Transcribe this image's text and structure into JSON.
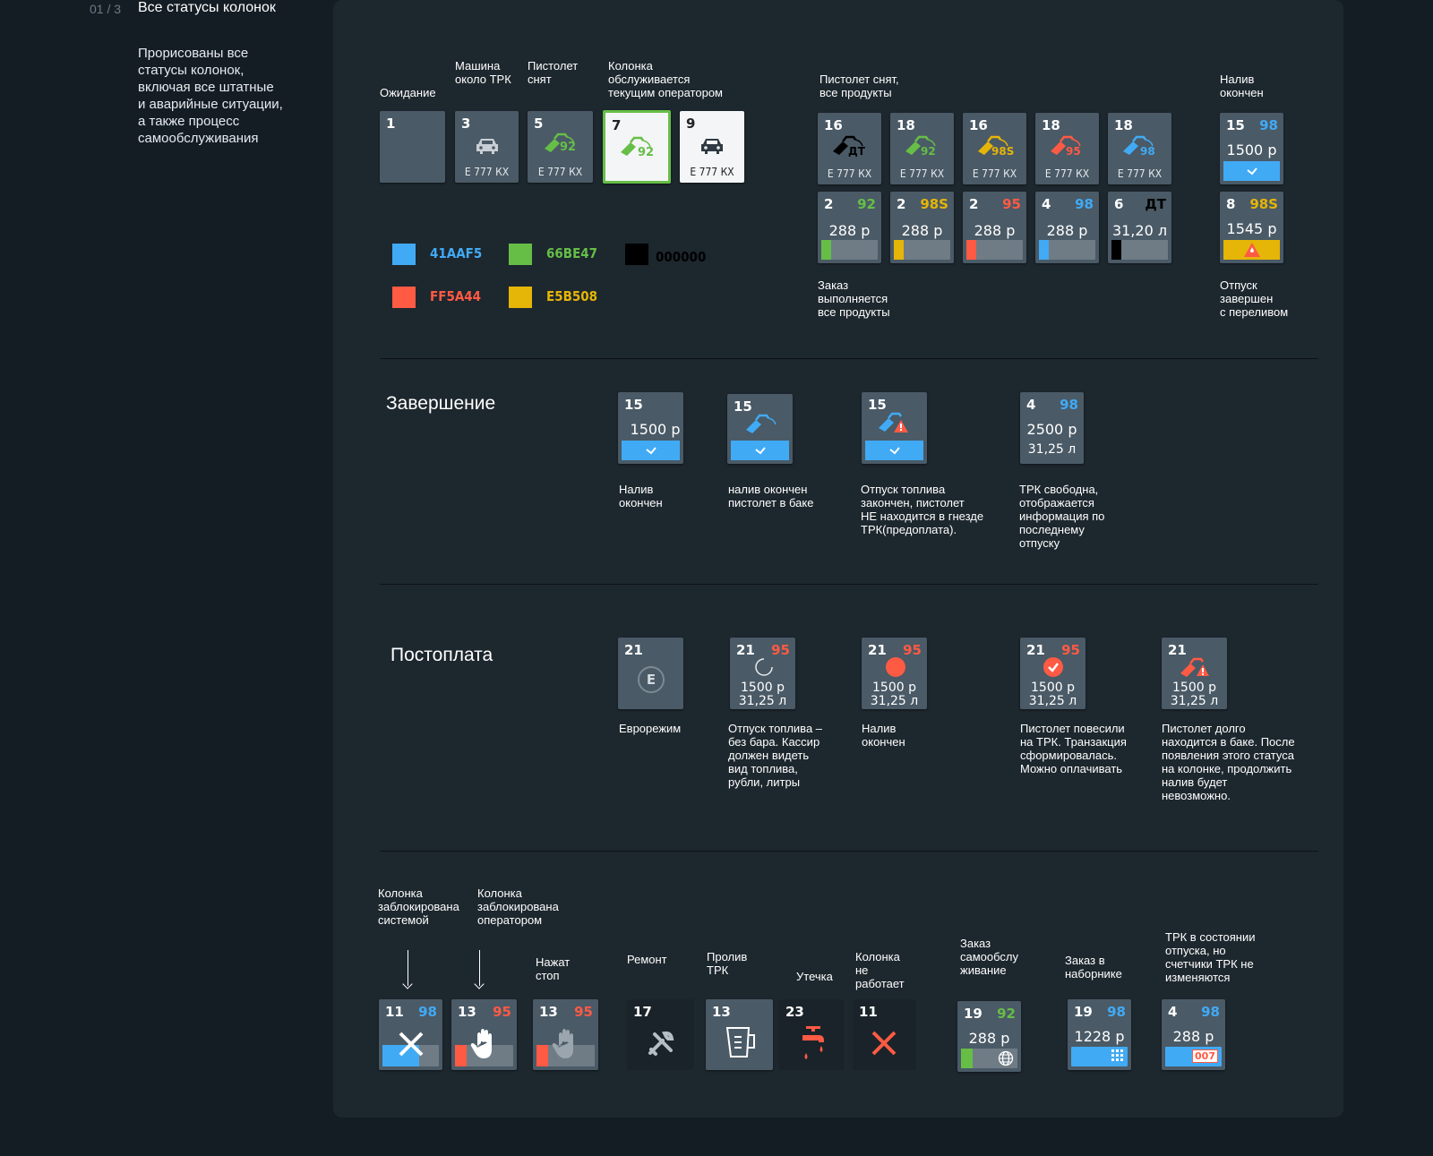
{
  "colors": {
    "blue": "#41AAF5",
    "green": "#66BE47",
    "black": "#000000",
    "red": "#FF5A44",
    "yellow": "#E5B508",
    "tile": "#4a5a66"
  },
  "header": {
    "pager": "01 / 3",
    "title": "Все статусы колонок",
    "intro": "Прорисованы все\nстатусы колонок,\nвключая все штатные\nи аварийные ситуации,\nа также процесс\nсамообслуживания"
  },
  "top": {
    "labels": {
      "wait": "Ожидание",
      "car": "Машина\nоколо ТРК",
      "nozzle": "Пистолет\nснят",
      "served": "Колонка\nобслуживается\nтекущим оператором",
      "all_products": "Пистолет снят,\nвсе  продукты",
      "fill_done": "Налив\nокончен",
      "order_running": "Заказ\nвыполняется\nвсе  продукты",
      "overflow": "Отпуск\nзавершен\nс переливом"
    },
    "tiles": [
      {
        "num": "1"
      },
      {
        "num": "3",
        "plate": "Е 777 КХ",
        "icon": "car-icon"
      },
      {
        "num": "5",
        "plate": "Е 777 КХ",
        "grade": "92",
        "icon": "nozzle-icon"
      },
      {
        "num": "7",
        "grade": "92",
        "icon": "nozzle-icon"
      },
      {
        "num": "9",
        "plate": "Е 777 КХ",
        "icon": "car-icon"
      }
    ],
    "products": [
      {
        "num": "16",
        "grade": "ДТ",
        "plate": "Е 777 КХ"
      },
      {
        "num": "18",
        "grade": "92",
        "plate": "Е 777 КХ"
      },
      {
        "num": "16",
        "grade": "98S",
        "plate": "Е 777 КХ"
      },
      {
        "num": "18",
        "grade": "95",
        "plate": "Е 777 КХ"
      },
      {
        "num": "18",
        "grade": "98",
        "plate": "Е 777 КХ"
      }
    ],
    "orders": [
      {
        "num": "2",
        "grade": "92",
        "amount": "288 р",
        "progress": 0.18
      },
      {
        "num": "2",
        "grade": "98S",
        "amount": "288 р",
        "progress": 0.18
      },
      {
        "num": "2",
        "grade": "95",
        "amount": "288 р",
        "progress": 0.18
      },
      {
        "num": "4",
        "grade": "98",
        "amount": "288 р",
        "progress": 0.18
      },
      {
        "num": "6",
        "grade": "ДТ",
        "amount": "31,20 л",
        "progress": 0.18
      }
    ],
    "done": {
      "num": "15",
      "grade": "98",
      "amount": "1500 р"
    },
    "overflow_tile": {
      "num": "8",
      "grade": "98S",
      "amount": "1545 р"
    },
    "swatches": [
      "41AAF5",
      "66BE47",
      "000000",
      "FF5A44",
      "E5B508"
    ]
  },
  "completion": {
    "title": "Завершение",
    "tiles": [
      {
        "num": "15",
        "amount": "1500 р",
        "caption": "Налив\nокончен"
      },
      {
        "num": "15",
        "caption": "налив окончен\nпистолет в баке"
      },
      {
        "num": "15",
        "caption": "Отпуск топлива\nзакончен, пистолет\nНЕ находится в гнезде\nТРК(предоплата)."
      },
      {
        "num": "4",
        "grade": "98",
        "amount": "2500 р",
        "litres": "31,25 л",
        "caption": "ТРК  свободна,\nотображается\nинформация  по\nпоследнему\nотпуску"
      }
    ]
  },
  "postpay": {
    "title": "Постоплата",
    "tiles": [
      {
        "num": "21",
        "badge": "E",
        "caption": "Еврорежим"
      },
      {
        "num": "21",
        "grade": "95",
        "amount": "1500 р",
        "litres": "31,25 л",
        "caption": "Отпуск топлива –\nбез бара. Кассир\nдолжен видеть\nвид топлива,\nрубли, литры"
      },
      {
        "num": "21",
        "grade": "95",
        "amount": "1500 р",
        "litres": "31,25 л",
        "caption": "Налив\nокончен"
      },
      {
        "num": "21",
        "grade": "95",
        "amount": "1500 р",
        "litres": "31,25 л",
        "caption": "Пистолет повесили\nна ТРК. Транзакция\nсформировалась.\nМожно оплачивать"
      },
      {
        "num": "21",
        "amount": "1500 р",
        "litres": "31,25 л",
        "caption": "Пистолет долго\nнаходится в баке. После\nпоявления этого статуса\nна колонке, продолжить\nналив будет\nневозможно."
      }
    ]
  },
  "alarms": {
    "labels": {
      "sys_block": "Колонка\nзаблокирована\nсистемой",
      "op_block": "Колонка\nзаблокирована\nоператором",
      "stop": "Нажат\nстоп",
      "repair": "Ремонт",
      "spill": "Пролив\nТРК",
      "leak": "Утечка",
      "broken": "Колонка\nне\nработает",
      "self": "Заказ\nсамообслу\nживание",
      "kiosk": "Заказ в\nнаборнике",
      "counter": "ТРК в состоянии\nотпуска, но\nсчетчики ТРК не\nизменяются"
    },
    "tiles": [
      {
        "num": "11",
        "grade": "98"
      },
      {
        "num": "13",
        "grade": "95"
      },
      {
        "num": "13",
        "grade": "95"
      },
      {
        "num": "17"
      },
      {
        "num": "13"
      },
      {
        "num": "23"
      },
      {
        "num": "11"
      },
      {
        "num": "19",
        "grade": "92",
        "amount": "288 р"
      },
      {
        "num": "19",
        "grade": "98",
        "amount": "1228 р"
      },
      {
        "num": "4",
        "grade": "98",
        "amount": "288 р",
        "counter": "007"
      }
    ]
  }
}
